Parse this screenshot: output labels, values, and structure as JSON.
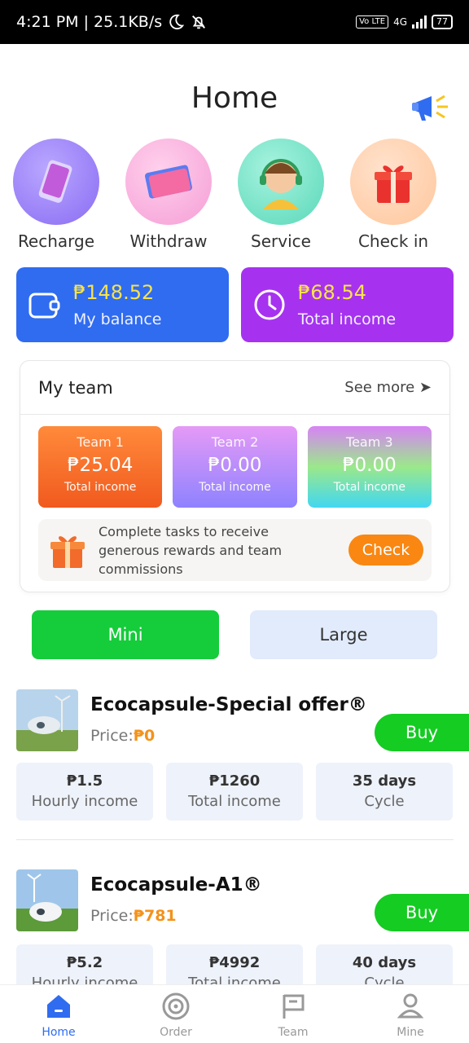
{
  "status_bar": {
    "time_speed": "4:21 PM | 25.1KB/s",
    "volte": "Vo LTE",
    "network": "4G",
    "battery": "77"
  },
  "header": {
    "title": "Home"
  },
  "quick_actions": [
    {
      "label": "Recharge",
      "icon": "phone-icon"
    },
    {
      "label": "Withdraw",
      "icon": "card-icon"
    },
    {
      "label": "Service",
      "icon": "support-agent-icon"
    },
    {
      "label": "Check in",
      "icon": "gift-icon"
    }
  ],
  "summary_cards": {
    "balance": {
      "amount": "₱148.52",
      "label": "My balance"
    },
    "income": {
      "amount": "₱68.54",
      "label": "Total income"
    }
  },
  "team": {
    "title": "My team",
    "see_more": "See more ➤",
    "boxes": [
      {
        "name": "Team 1",
        "value": "₱25.04",
        "label": "Total income"
      },
      {
        "name": "Team 2",
        "value": "₱0.00",
        "label": "Total income"
      },
      {
        "name": "Team 3",
        "value": "₱0.00",
        "label": "Total income"
      }
    ],
    "task_text": "Complete tasks to receive generous rewards and team commissions",
    "check_label": "Check"
  },
  "toggle": {
    "mini": "Mini",
    "large": "Large"
  },
  "products": [
    {
      "name": "Ecocapsule-Special offer®",
      "price_label": "Price:",
      "price": "₱0",
      "buy": "Buy",
      "stats": [
        {
          "value": "₱1.5",
          "label": "Hourly income"
        },
        {
          "value": "₱1260",
          "label": "Total income"
        },
        {
          "value": "35 days",
          "label": "Cycle"
        }
      ]
    },
    {
      "name": "Ecocapsule-A1®",
      "price_label": "Price:",
      "price": "₱781",
      "buy": "Buy",
      "stats": [
        {
          "value": "₱5.2",
          "label": "Hourly income"
        },
        {
          "value": "₱4992",
          "label": "Total income"
        },
        {
          "value": "40 days",
          "label": "Cycle"
        }
      ]
    }
  ],
  "tabs": [
    {
      "label": "Home",
      "icon": "home-icon",
      "active": true
    },
    {
      "label": "Order",
      "icon": "order-icon",
      "active": false
    },
    {
      "label": "Team",
      "icon": "team-flag-icon",
      "active": false
    },
    {
      "label": "Mine",
      "icon": "user-icon",
      "active": false
    }
  ],
  "colors": {
    "blue": "#2f6cf0",
    "purple": "#a632f0",
    "green": "#15cc22",
    "orange": "#f98712",
    "amount_yellow": "#f7e24d"
  }
}
